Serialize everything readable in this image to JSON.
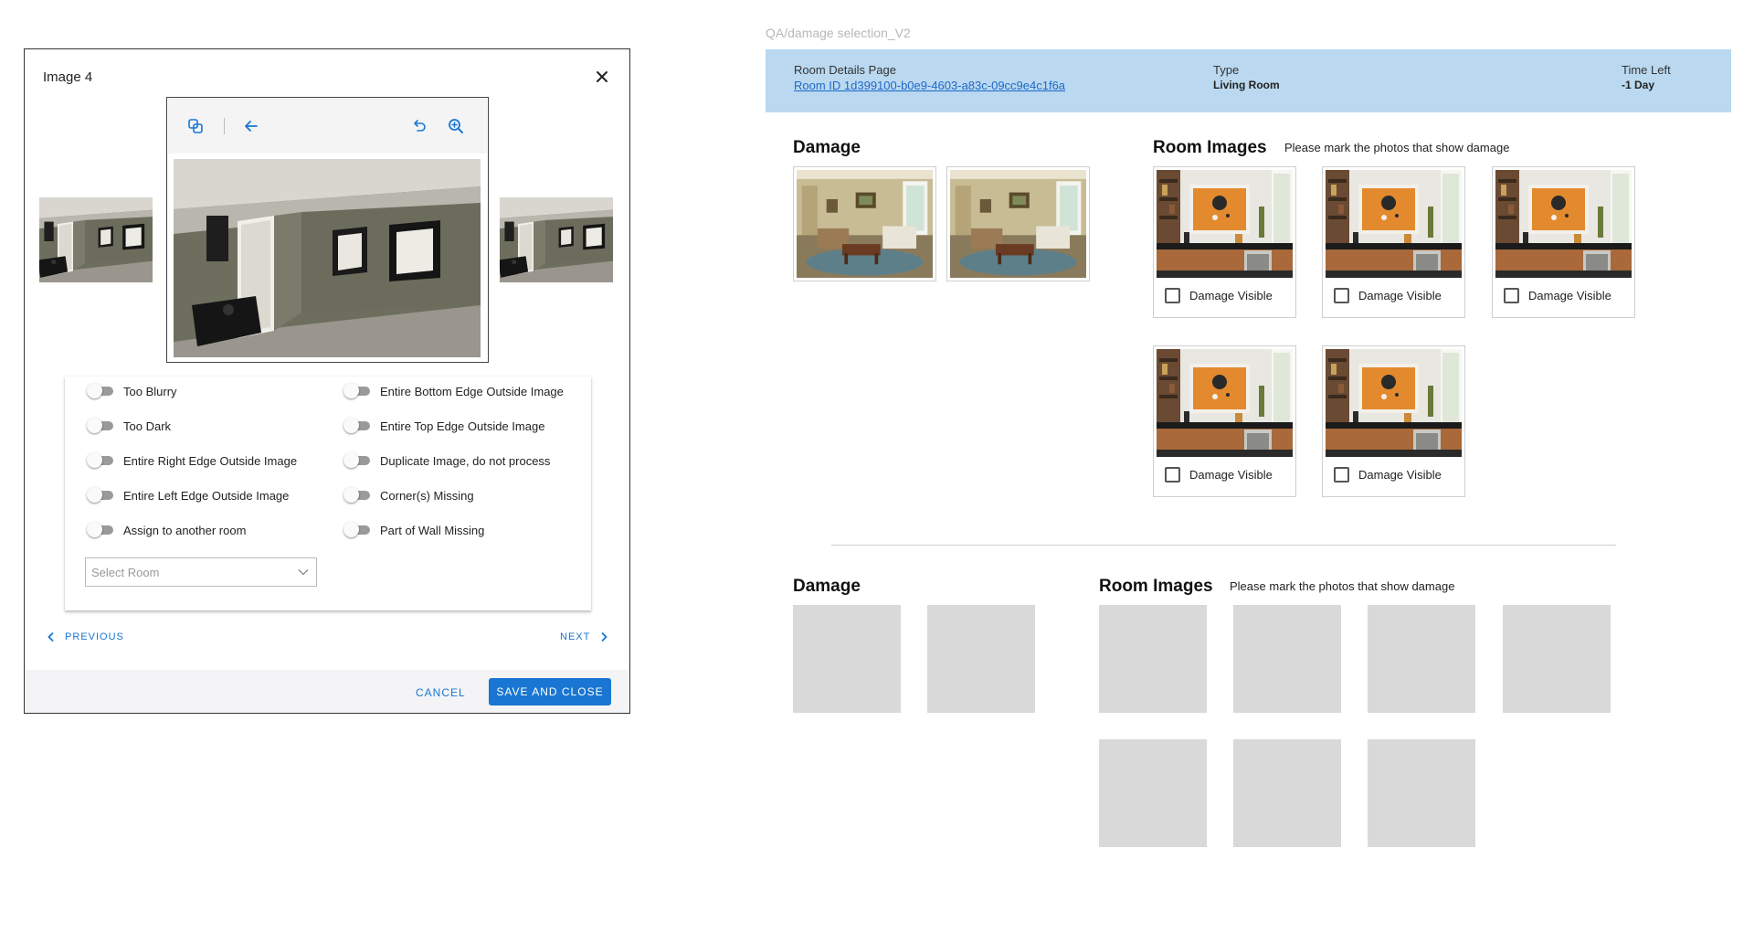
{
  "modal": {
    "title": "Image 4",
    "options_left": [
      {
        "label": "Too Blurry",
        "on": false
      },
      {
        "label": "Too Dark",
        "on": false
      },
      {
        "label": "Entire Right Edge Outside Image",
        "on": false
      },
      {
        "label": "Entire Left Edge Outside Image",
        "on": false
      },
      {
        "label": "Assign to another room",
        "on": false
      }
    ],
    "options_right": [
      {
        "label": "Entire Bottom Edge Outside Image",
        "on": false
      },
      {
        "label": "Entire Top Edge Outside Image",
        "on": false
      },
      {
        "label": "Duplicate Image, do not process",
        "on": false
      },
      {
        "label": "Corner(s) Missing",
        "on": false
      },
      {
        "label": "Part of Wall Missing",
        "on": false
      }
    ],
    "select_room_placeholder": "Select Room",
    "previous_label": "PREVIOUS",
    "next_label": "NEXT",
    "cancel_label": "CANCEL",
    "save_label": "SAVE AND CLOSE"
  },
  "page": {
    "frame_label": "QA/damage selection_V2",
    "header": {
      "room_details_label": "Room Details Page",
      "room_id_link": "Room ID 1d399100-b0e9-4603-a83c-09cc9e4c1f6a",
      "type_label": "Type",
      "type_value": "Living Room",
      "time_left_label": "Time Left",
      "time_left_value": "-1 Day"
    },
    "section1": {
      "damage_title": "Damage",
      "room_images_title": "Room Images",
      "room_images_hint": "Please mark the photos that show damage",
      "checkbox_label": "Damage Visible"
    },
    "section2": {
      "damage_title": "Damage",
      "room_images_title": "Room Images",
      "room_images_hint": "Please mark the photos that show damage"
    }
  },
  "colors": {
    "accent": "#1976d2",
    "header_bg": "#bad9f0",
    "placeholder_gray": "#d9d9d9"
  },
  "icons": [
    "close-icon",
    "crop-icon",
    "back-arrow-icon",
    "undo-icon",
    "zoom-in-icon",
    "chevron-down-icon",
    "chevron-left-icon",
    "chevron-right-icon"
  ]
}
